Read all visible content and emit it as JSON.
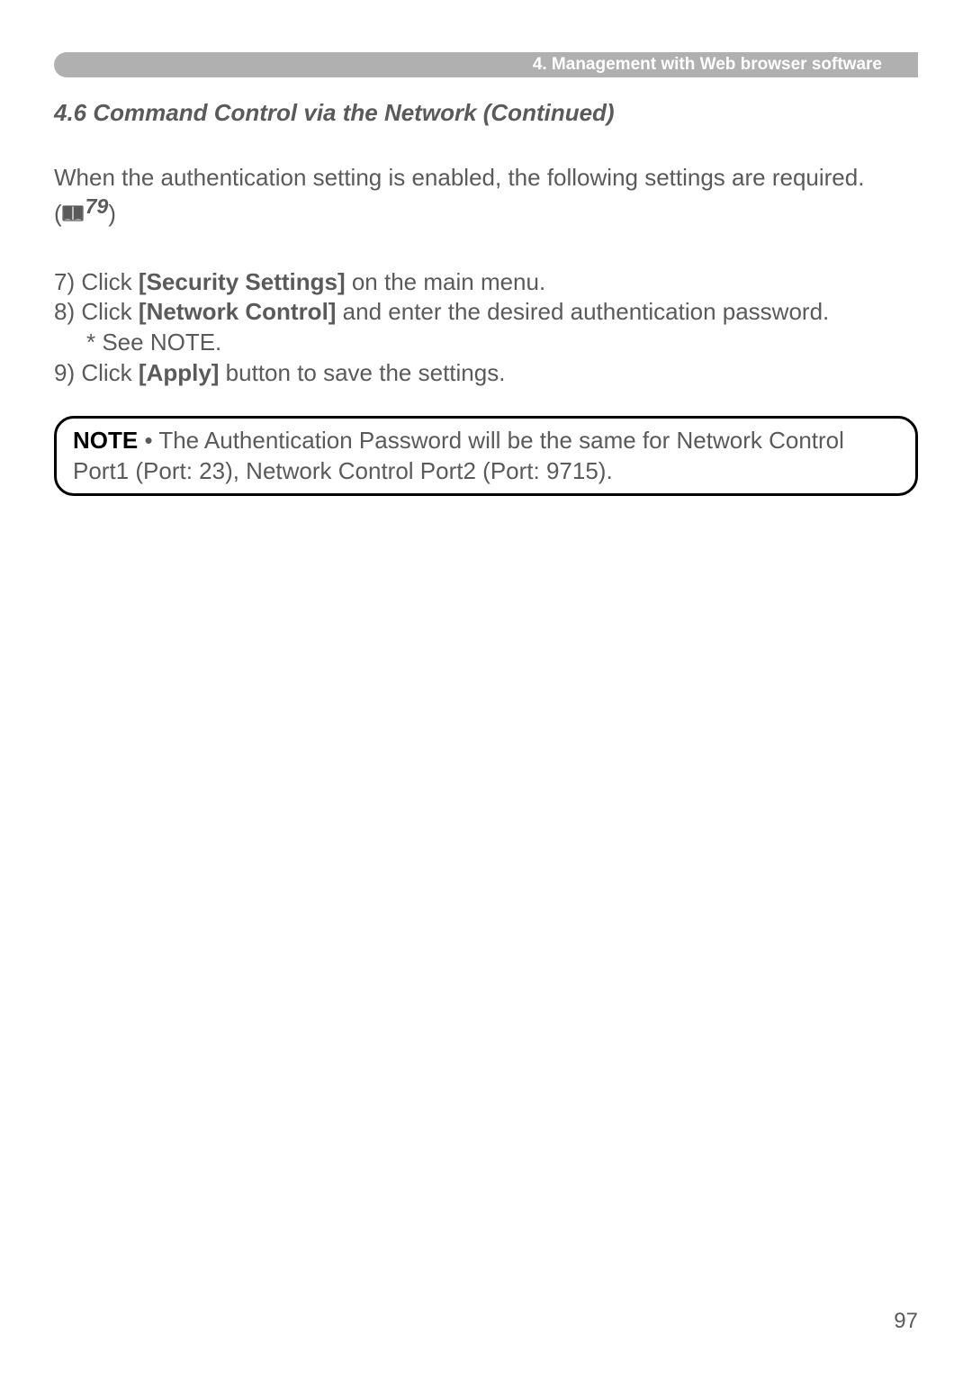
{
  "header": {
    "breadcrumb": "4. Management with Web browser software"
  },
  "section": {
    "title": "4.6 Command Control via the Network (Continued)"
  },
  "intro": {
    "text": "When the authentication setting is enabled, the following settings are required.",
    "ref_page": "79"
  },
  "steps": {
    "s7_pre": "7) Click ",
    "s7_bold": "[Security Settings]",
    "s7_post": " on the main menu.",
    "s8_pre": "8) Click ",
    "s8_bold": "[Network Control]",
    "s8_post": " and enter the desired authentication password.",
    "s8_sub": "* See NOTE.",
    "s9_pre": "9) Click ",
    "s9_bold": "[Apply]",
    "s9_post": " button to save the settings."
  },
  "note": {
    "label": "NOTE",
    "text": " • The Authentication Password will be the same for Network Control Port1 (Port: 23), Network Control Port2 (Port: 9715)."
  },
  "page_number": "97"
}
